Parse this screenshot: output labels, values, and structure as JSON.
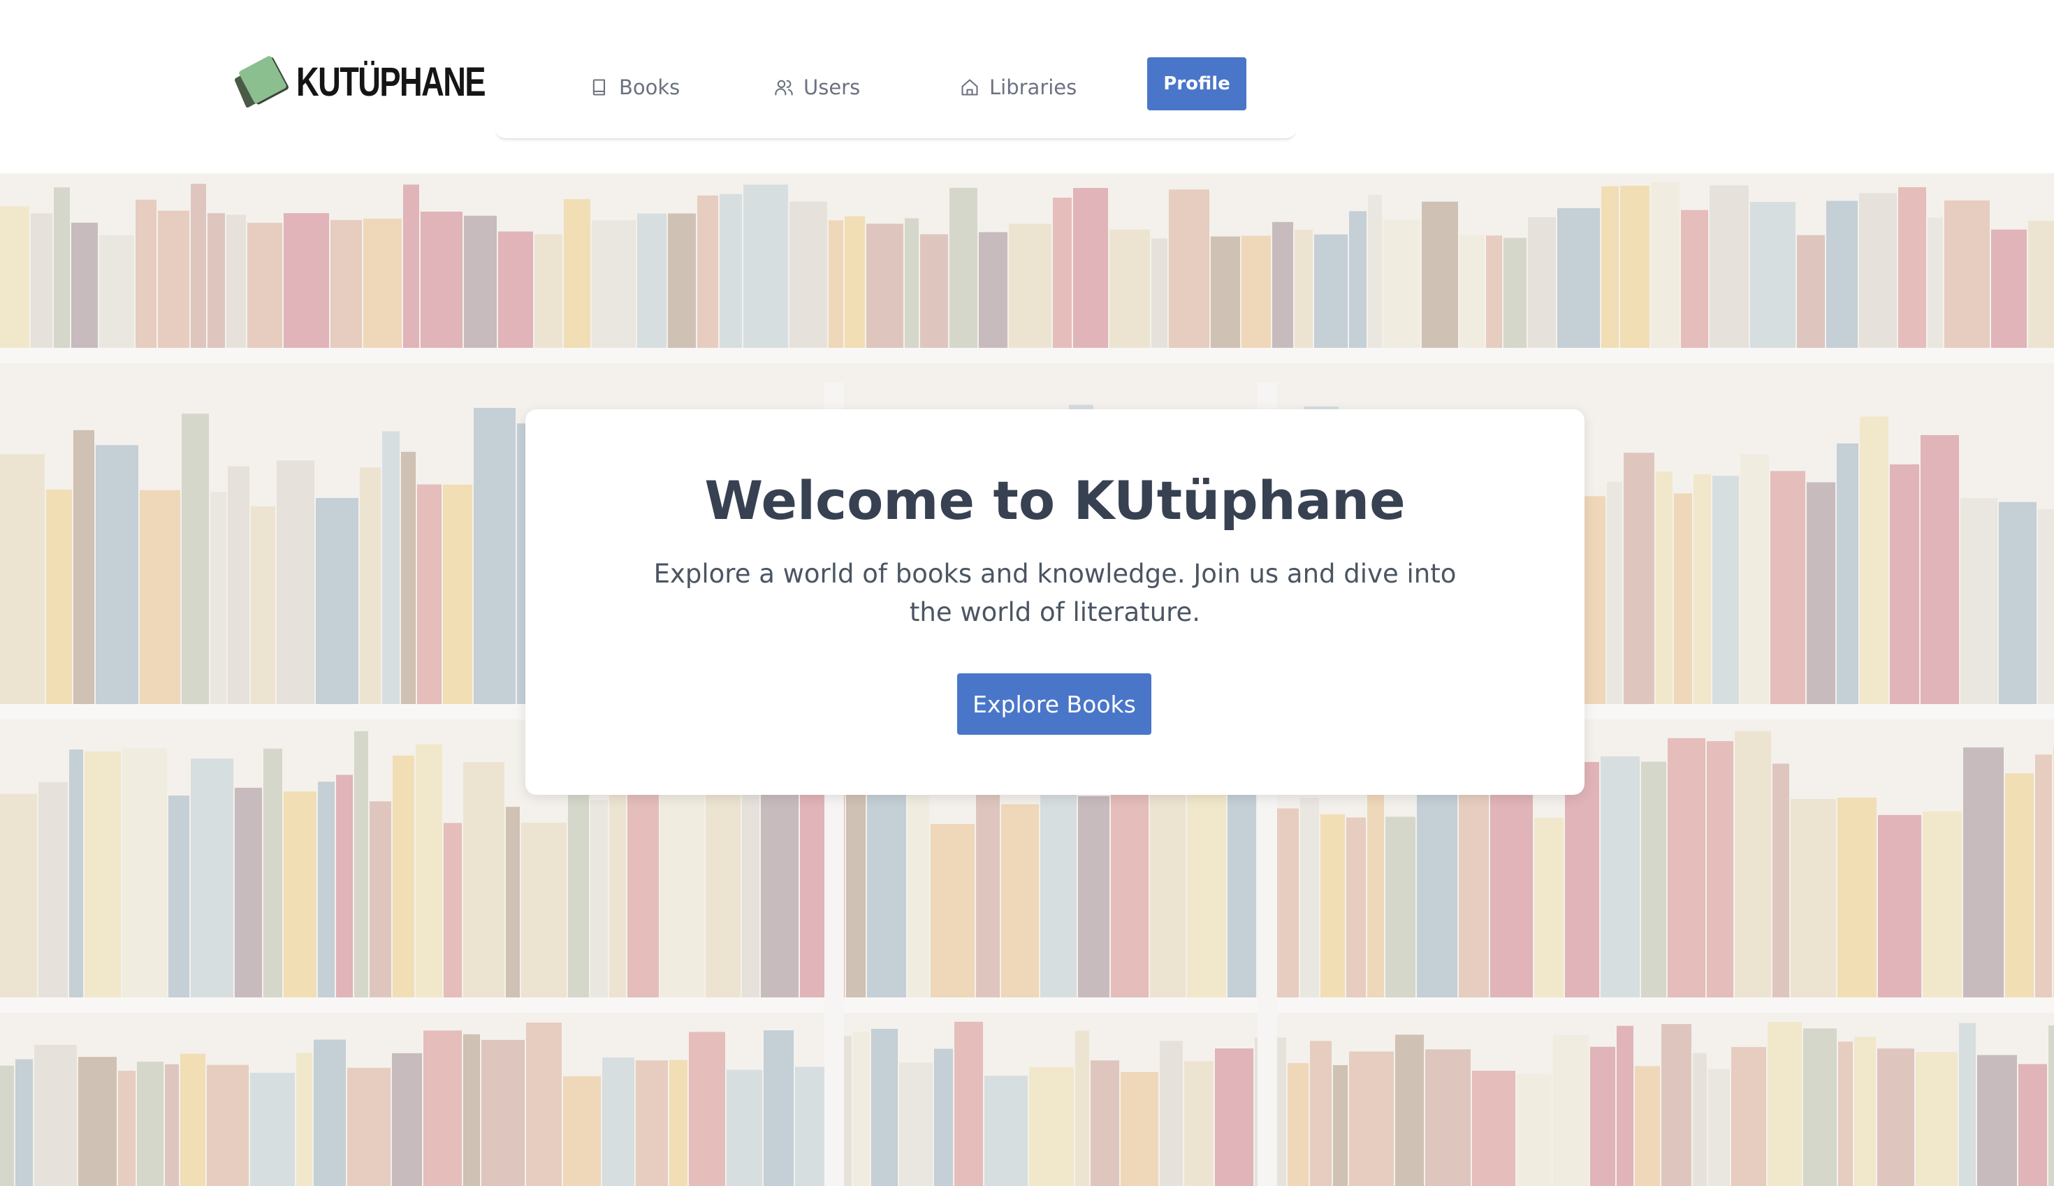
{
  "brand": {
    "name": "KUTÜPHANE",
    "logo_icon": "book-logo-icon"
  },
  "nav": {
    "items": [
      {
        "label": "Books",
        "icon": "book-icon"
      },
      {
        "label": "Users",
        "icon": "users-icon"
      },
      {
        "label": "Libraries",
        "icon": "home-icon"
      }
    ],
    "profile_label": "Profile"
  },
  "hero": {
    "title": "Welcome to KUtüphane",
    "subtitle": "Explore a world of books and knowledge. Join us and dive into the world of literature.",
    "cta_label": "Explore Books",
    "background": "bookshelf-photo"
  },
  "colors": {
    "accent": "#4a76c9",
    "nav_text": "#6b7280",
    "title_text": "#374151",
    "body_text": "#4b5563"
  }
}
